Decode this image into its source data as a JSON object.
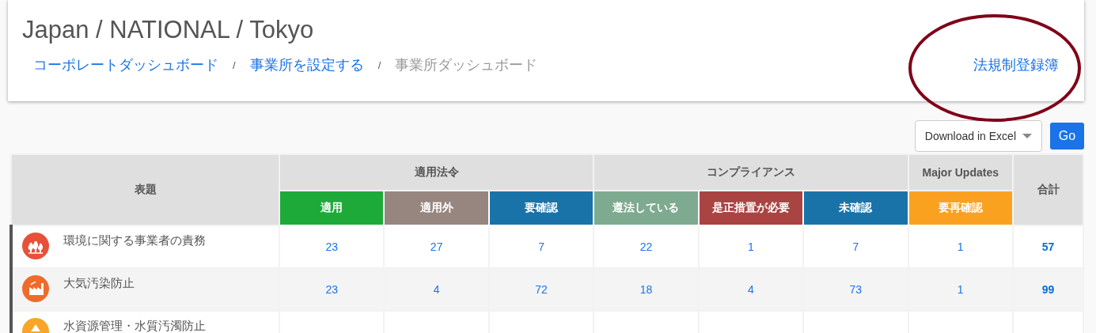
{
  "header": {
    "title": "Japan / NATIONAL / Tokyo",
    "breadcrumbs": [
      {
        "label": "コーポレートダッシュボード",
        "current": false
      },
      {
        "label": "事業所を設定する",
        "current": false
      },
      {
        "label": "事業所ダッシュボード",
        "current": true
      }
    ],
    "link": "法規制登録簿",
    "separator": "/"
  },
  "annotations": [
    {
      "kind": "ellipse"
    }
  ],
  "toolbar": {
    "select": "Download in Excel",
    "button": "Go"
  },
  "table": {
    "title_column": "表題",
    "total_column": "合計",
    "groups": [
      {
        "label": "適用法令",
        "columns": [
          {
            "label": "適用",
            "color": "#1eaa39"
          },
          {
            "label": "適用外",
            "color": "#978680"
          },
          {
            "label": "要確認",
            "color": "#1a73a8"
          }
        ]
      },
      {
        "label": "コンプライアンス",
        "columns": [
          {
            "label": "遵法している",
            "color": "#7eaa90"
          },
          {
            "label": "是正措置が必要",
            "color": "#a94442"
          },
          {
            "label": "未確認",
            "color": "#1a73a8"
          }
        ]
      },
      {
        "label": "Major Updates",
        "columns": [
          {
            "label": "要再確認",
            "color": "#fba122"
          }
        ]
      }
    ],
    "rows": [
      {
        "title": "環境に関する事業者の責務",
        "kind": "trees",
        "color": "#e8503a",
        "values": [
          "23",
          "27",
          "7",
          "22",
          "1",
          "7",
          "1"
        ],
        "total": "57"
      },
      {
        "title": "大気汚染防止",
        "kind": "factory",
        "color": "#f06b2b",
        "values": [
          "23",
          "4",
          "72",
          "18",
          "4",
          "73",
          "1"
        ],
        "total": "99"
      },
      {
        "title": "水資源管理・水質汚濁防止",
        "kind": "drop",
        "color": "#f9a527",
        "values": [],
        "total": ""
      }
    ]
  }
}
